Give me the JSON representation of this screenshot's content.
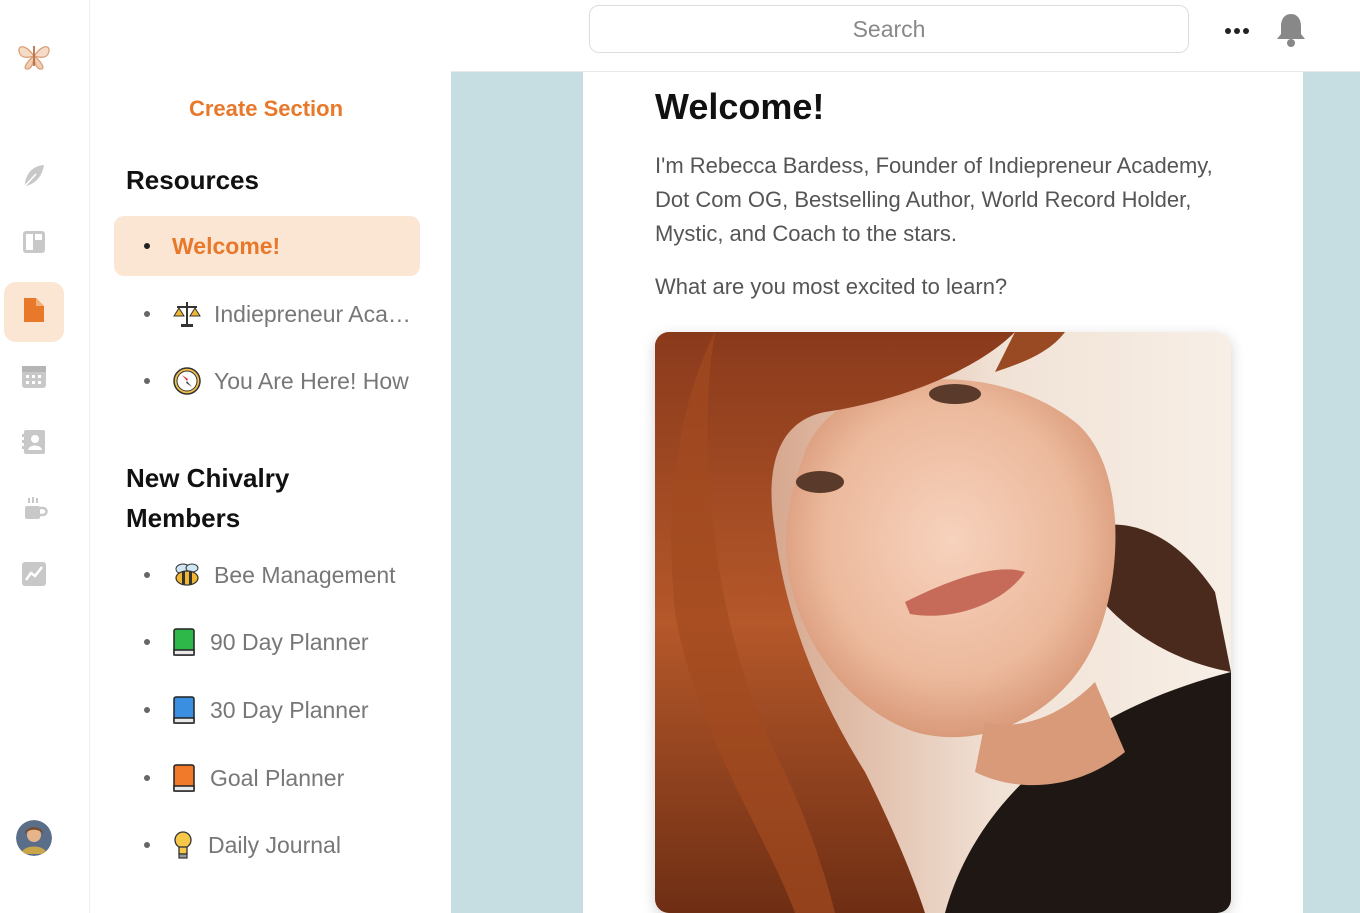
{
  "rail": {
    "logo": "butterfly-logo",
    "items": [
      {
        "icon": "feather-icon",
        "active": false
      },
      {
        "icon": "layout-icon",
        "active": false
      },
      {
        "icon": "document-icon",
        "active": true
      },
      {
        "icon": "calendar-icon",
        "active": false
      },
      {
        "icon": "contacts-icon",
        "active": false
      },
      {
        "icon": "coffee-icon",
        "active": false
      },
      {
        "icon": "chart-icon",
        "active": false
      }
    ],
    "avatar": "user-avatar"
  },
  "sidebar": {
    "create_section": "Create Section",
    "groups": [
      {
        "title": "Resources",
        "items": [
          {
            "label": "Welcome!",
            "active": true,
            "emoji": ""
          },
          {
            "label": "Indiepreneur Academy",
            "emoji": "scales-icon"
          },
          {
            "label": "You Are Here! How",
            "emoji": "compass-icon"
          }
        ]
      },
      {
        "title": "New Chivalry Members",
        "items": [
          {
            "label": "Bee Management",
            "emoji": "bee-icon"
          },
          {
            "label": "90 Day Planner",
            "emoji": "green-book-icon"
          },
          {
            "label": "30 Day Planner",
            "emoji": "blue-book-icon"
          },
          {
            "label": "Goal Planner",
            "emoji": "orange-book-icon"
          },
          {
            "label": "Daily Journal",
            "emoji": "lightbulb-icon"
          }
        ]
      }
    ]
  },
  "topbar": {
    "search_placeholder": "Search"
  },
  "content": {
    "title": "Welcome!",
    "intro": "I'm Rebecca Bardess, Founder of Indiepreneur Academy, Dot Com OG, Bestselling Author, World Record Holder, Mystic, and Coach to the stars.",
    "question": "What are you most excited to learn?"
  },
  "colors": {
    "accent": "#e8782a",
    "accent_bg": "#fbe6d3",
    "content_bg": "#c6dde2"
  }
}
